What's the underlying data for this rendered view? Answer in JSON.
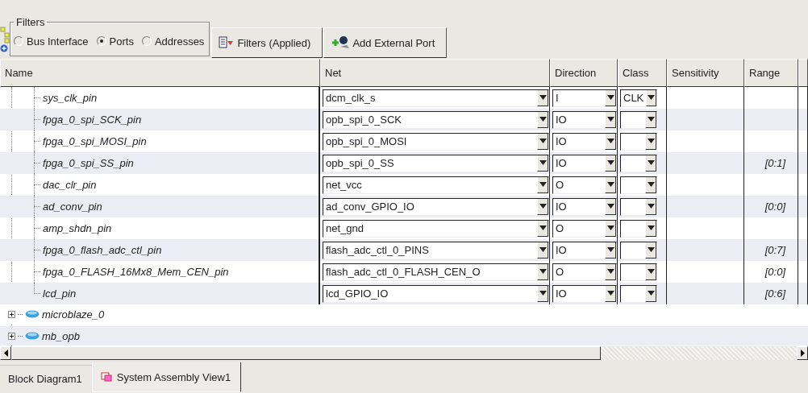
{
  "filters": {
    "title": "Filters",
    "options": [
      {
        "label": "Bus Interface",
        "selected": false
      },
      {
        "label": "Ports",
        "selected": true
      },
      {
        "label": "Addresses",
        "selected": false
      }
    ]
  },
  "toolbar_buttons": [
    {
      "label": "Filters (Applied)",
      "kind": "filter"
    },
    {
      "label": "Add External Port",
      "kind": "add-port"
    }
  ],
  "table": {
    "columns": [
      "Name",
      "Net",
      "Direction",
      "Class",
      "Sensitivity",
      "Range"
    ],
    "rows": [
      {
        "name": "sys_clk_pin",
        "net": "dcm_clk_s",
        "direction": "I",
        "class": "CLK"
      },
      {
        "name": "fpga_0_spi_SCK_pin",
        "net": "opb_spi_0_SCK",
        "direction": "IO"
      },
      {
        "name": "fpga_0_spi_MOSI_pin",
        "net": "opb_spi_0_MOSI",
        "direction": "IO"
      },
      {
        "name": "fpga_0_spi_SS_pin",
        "net": "opb_spi_0_SS",
        "direction": "IO",
        "range": "[0:1]"
      },
      {
        "name": "dac_clr_pin",
        "net": "net_vcc",
        "direction": "O"
      },
      {
        "name": "ad_conv_pin",
        "net": "ad_conv_GPIO_IO",
        "direction": "IO",
        "range": "[0:0]"
      },
      {
        "name": "amp_shdn_pin",
        "net": "net_gnd",
        "direction": "O"
      },
      {
        "name": "fpga_0_flash_adc_ctl_pin",
        "net": "flash_adc_ctl_0_PINS",
        "direction": "IO",
        "range": "[0:7]"
      },
      {
        "name": "fpga_0_FLASH_16Mx8_Mem_CEN_pin",
        "net": "flash_adc_ctl_0_FLASH_CEN_O",
        "direction": "O",
        "range": "[0:0]"
      },
      {
        "name": "lcd_pin",
        "net": "lcd_GPIO_IO",
        "direction": "IO",
        "range": "[0:6]"
      }
    ],
    "instances": [
      {
        "name": "microblaze_0",
        "expanded": false
      },
      {
        "name": "mb_opb",
        "expanded": false
      }
    ]
  },
  "tabs": [
    {
      "label": "Block Diagram1",
      "selected": false
    },
    {
      "label": "System Assembly View1",
      "selected": true
    }
  ]
}
